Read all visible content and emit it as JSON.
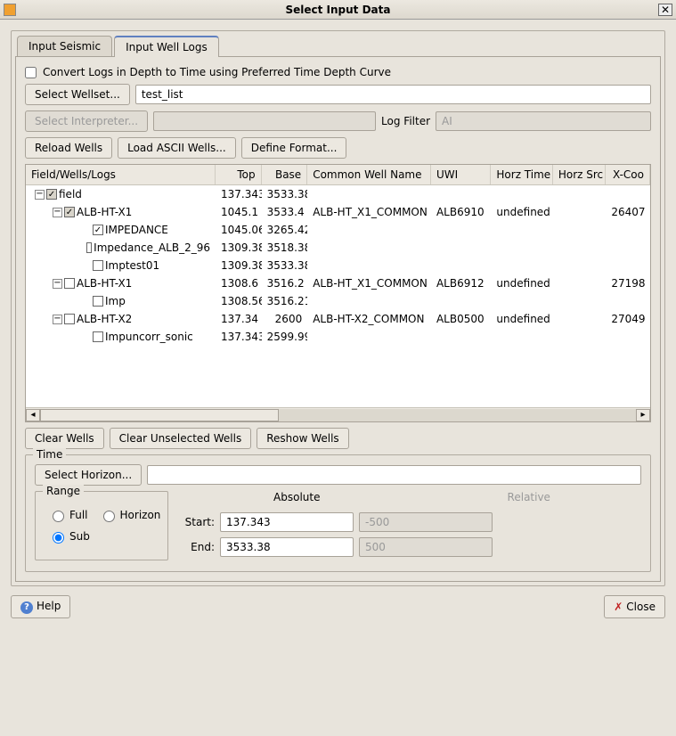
{
  "title": "Select Input Data",
  "tabs": {
    "seismic": "Input Seismic",
    "logs": "Input Well Logs"
  },
  "convert_label": "Convert Logs in Depth to Time using Preferred Time Depth Curve",
  "select_wellset": "Select Wellset...",
  "wellset_value": "test_list",
  "select_interpreter": "Select Interpreter...",
  "log_filter_label": "Log Filter",
  "log_filter_value": "AI",
  "reload_wells": "Reload Wells",
  "load_ascii": "Load ASCII Wells...",
  "define_format": "Define Format...",
  "headers": {
    "name": "Field/Wells/Logs",
    "top": "Top",
    "base": "Base",
    "common": "Common Well Name",
    "uwi": "UWI",
    "horz": "Horz Time",
    "src": "Horz Src",
    "xc": "X-Coo"
  },
  "tree": [
    {
      "lvl": 0,
      "exp": "−",
      "chk": true,
      "gray": true,
      "name": "field",
      "top": "137.343",
      "base": "3533.38",
      "common": "",
      "uwi": "",
      "horz": "",
      "src": "",
      "xc": ""
    },
    {
      "lvl": 1,
      "exp": "−",
      "chk": true,
      "gray": true,
      "name": "ALB-HT-X1",
      "top": "1045.1",
      "base": "3533.4",
      "common": "ALB-HT_X1_COMMON",
      "uwi": "ALB6910",
      "horz": "undefined",
      "src": "",
      "xc": "26407"
    },
    {
      "lvl": 2,
      "exp": "",
      "chk": true,
      "gray": false,
      "name": "IMPEDANCE",
      "top": "1045.06",
      "base": "3265.42",
      "common": "",
      "uwi": "",
      "horz": "",
      "src": "",
      "xc": ""
    },
    {
      "lvl": 2,
      "exp": "",
      "chk": false,
      "gray": false,
      "name": "Impedance_ALB_2_96",
      "top": "1309.38",
      "base": "3518.38",
      "common": "",
      "uwi": "",
      "horz": "",
      "src": "",
      "xc": ""
    },
    {
      "lvl": 2,
      "exp": "",
      "chk": false,
      "gray": false,
      "name": "Imptest01",
      "top": "1309.38",
      "base": "3533.38",
      "common": "",
      "uwi": "",
      "horz": "",
      "src": "",
      "xc": ""
    },
    {
      "lvl": 1,
      "exp": "−",
      "chk": false,
      "gray": false,
      "name": "ALB-HT-X1",
      "top": "1308.6",
      "base": "3516.2",
      "common": "ALB-HT_X1_COMMON",
      "uwi": "ALB6912",
      "horz": "undefined",
      "src": "",
      "xc": "27198"
    },
    {
      "lvl": 2,
      "exp": "",
      "chk": false,
      "gray": false,
      "name": "Imp",
      "top": "1308.56",
      "base": "3516.21",
      "common": "",
      "uwi": "",
      "horz": "",
      "src": "",
      "xc": ""
    },
    {
      "lvl": 1,
      "exp": "−",
      "chk": false,
      "gray": false,
      "name": "ALB-HT-X2",
      "top": "137.34",
      "base": "2600",
      "common": "ALB-HT-X2_COMMON",
      "uwi": "ALB0500",
      "horz": "undefined",
      "src": "",
      "xc": "27049"
    },
    {
      "lvl": 2,
      "exp": "",
      "chk": false,
      "gray": false,
      "name": "Impuncorr_sonic",
      "top": "137.343",
      "base": "2599.99",
      "common": "",
      "uwi": "",
      "horz": "",
      "src": "",
      "xc": ""
    }
  ],
  "clear_wells": "Clear Wells",
  "clear_unselected": "Clear Unselected Wells",
  "reshow_wells": "Reshow Wells",
  "time_label": "Time",
  "select_horizon": "Select Horizon...",
  "range_label": "Range",
  "full": "Full",
  "horizon": "Horizon",
  "sub": "Sub",
  "absolute": "Absolute",
  "relative": "Relative",
  "start": "Start:",
  "end": "End:",
  "start_val": "137.343",
  "end_val": "3533.38",
  "rel_start": "-500",
  "rel_end": "500",
  "help": "Help",
  "close": "Close"
}
